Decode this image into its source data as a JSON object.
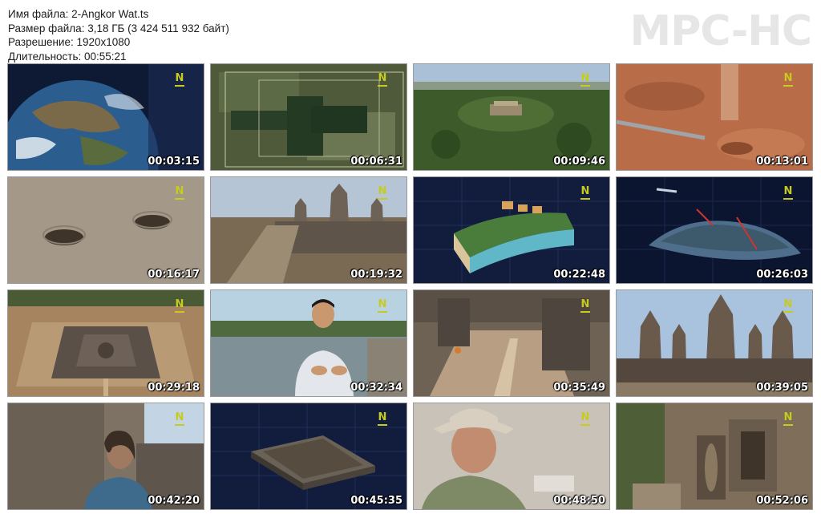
{
  "info": {
    "filename": "Имя файла: 2-Angkor Wat.ts",
    "filesize": "Размер файла: 3,18 ГБ (3 424 511 932 байт)",
    "resolution": "Разрешение: 1920x1080",
    "duration": "Длительность: 00:55:21"
  },
  "logo": "MPC-HC",
  "channel_mark": "N",
  "thumbnails": [
    {
      "time": "00:03:15",
      "scene": "earth-from-space"
    },
    {
      "time": "00:06:31",
      "scene": "satellite-map"
    },
    {
      "time": "00:09:46",
      "scene": "aerial-hill-forest"
    },
    {
      "time": "00:13:01",
      "scene": "soil-excavation"
    },
    {
      "time": "00:16:17",
      "scene": "holes-in-ground"
    },
    {
      "time": "00:19:32",
      "scene": "temple-causeway"
    },
    {
      "time": "00:22:48",
      "scene": "terrain-model-3d"
    },
    {
      "time": "00:26:03",
      "scene": "forest-3d-scan"
    },
    {
      "time": "00:29:18",
      "scene": "temple-aerial-top"
    },
    {
      "time": "00:32:34",
      "scene": "interview-lake"
    },
    {
      "time": "00:35:49",
      "scene": "temple-courtyard-aerial"
    },
    {
      "time": "00:39:05",
      "scene": "angkor-wat-towers"
    },
    {
      "time": "00:42:20",
      "scene": "man-at-ruins"
    },
    {
      "time": "00:45:35",
      "scene": "3d-platform-model"
    },
    {
      "time": "00:48:50",
      "scene": "man-in-hat"
    },
    {
      "time": "00:52:06",
      "scene": "carved-stone-wall"
    }
  ]
}
